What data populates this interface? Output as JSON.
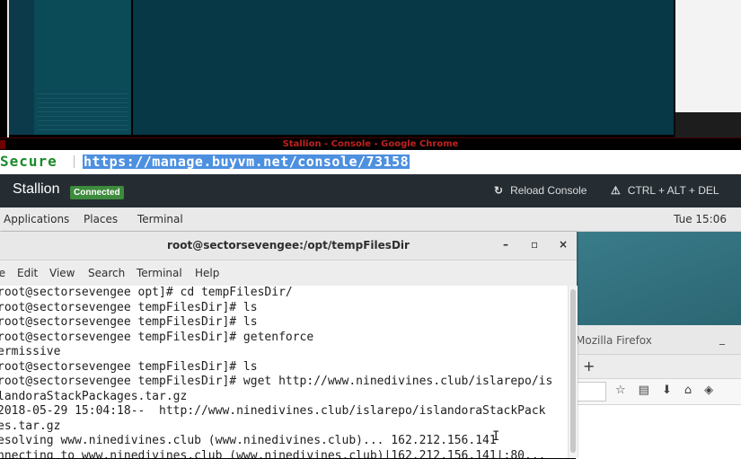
{
  "chrome": {
    "window_title": "Stallion - Console - Google Chrome",
    "secure_label": "Secure",
    "url": "https://manage.buyvm.net/console/73158"
  },
  "console": {
    "vm_name": "Stallion",
    "status_badge": "Connected",
    "reload_label": "Reload Console",
    "reload_icon": "refresh-icon",
    "cad_label": "CTRL + ALT + DEL",
    "cad_icon": "warning-icon"
  },
  "gnome": {
    "applications": "Applications",
    "places": "Places",
    "terminal": "Terminal",
    "clock": "Tue 15:06"
  },
  "terminal": {
    "title": "root@sectorsevengee:/opt/tempFilesDir",
    "min": "–",
    "max": "▫",
    "close": "×",
    "menus": [
      "ile",
      "Edit",
      "View",
      "Search",
      "Terminal",
      "Help"
    ],
    "lines": [
      "root@sectorsevengee opt]# cd tempFilesDir/",
      "root@sectorsevengee tempFilesDir]# ls",
      "root@sectorsevengee tempFilesDir]# ls",
      "root@sectorsevengee tempFilesDir]# getenforce",
      "ermissive",
      "root@sectorsevengee tempFilesDir]# ls",
      "root@sectorsevengee tempFilesDir]# wget http://www.ninedivines.club/islarepo/is",
      "landoraStackPackages.tar.gz",
      "2018-05-29 15:04:18--  http://www.ninedivines.club/islarepo/islandoraStackPack",
      "es.tar.gz",
      "esolving www.ninedivines.club (www.ninedivines.club)... 162.212.156.141",
      "nnecting to www.ninedivines.club (www.ninedivines.club)|162.212.156.141|:80..."
    ]
  },
  "firefox": {
    "title": "Mozilla Firefox",
    "min": "_",
    "new_tab": "+",
    "toolbar_icons": [
      "star-icon",
      "reading-list-icon",
      "download-icon",
      "home-icon",
      "shield-icon"
    ]
  }
}
